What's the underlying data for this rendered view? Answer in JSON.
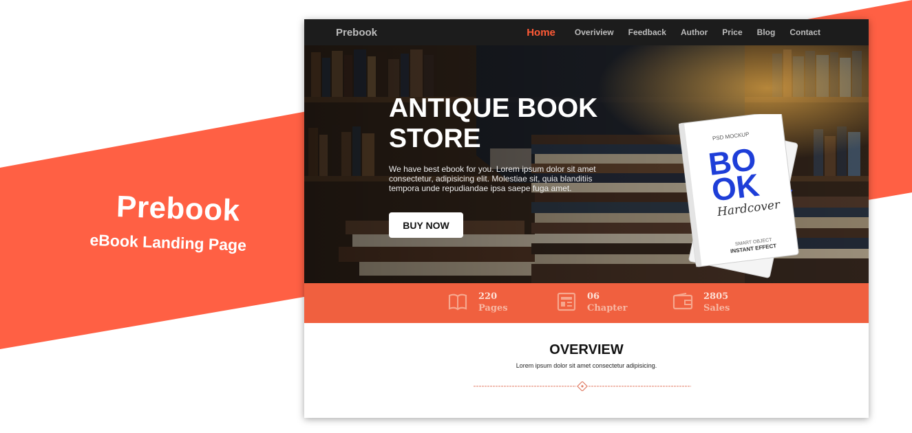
{
  "promo": {
    "title": "Prebook",
    "subtitle": "eBook Landing Page",
    "accent_color": "#ff6044"
  },
  "navbar": {
    "brand": "Prebook",
    "items": [
      {
        "label": "Home",
        "active": true
      },
      {
        "label": "Overiview",
        "active": false
      },
      {
        "label": "Feedback",
        "active": false
      },
      {
        "label": "Author",
        "active": false
      },
      {
        "label": "Price",
        "active": false
      },
      {
        "label": "Blog",
        "active": false
      },
      {
        "label": "Contact",
        "active": false
      }
    ],
    "active_color": "#ff5a36"
  },
  "hero": {
    "title_line1": "ANTIQUE BOOK",
    "title_line2": "STORE",
    "description": "We have best ebook for you. Lorem ipsum dolor sit amet consectetur, adipisicing elit. Molestiae sit, quia blanditiis tempora unde repudiandae ipsa saepe fuga amet.",
    "button_label": "BUY NOW",
    "book_cover": {
      "top_text": "PSD MOCKUP",
      "big_text_1": "BO",
      "big_text_2": "OK",
      "script_text": "Hardcover",
      "bottom_text_1": "SMART OBJECT",
      "bottom_text_2": "INSTANT EFFECT"
    }
  },
  "stats": {
    "background": "#f0603f",
    "items": [
      {
        "icon": "open-book-icon",
        "value": "220",
        "label": "Pages"
      },
      {
        "icon": "newspaper-icon",
        "value": "06",
        "label": "Chapter"
      },
      {
        "icon": "wallet-icon",
        "value": "2805",
        "label": "Sales"
      }
    ]
  },
  "overview": {
    "title": "OVERVIEW",
    "text": "Lorem ipsum dolor sit amet consectetur adipisicing."
  }
}
